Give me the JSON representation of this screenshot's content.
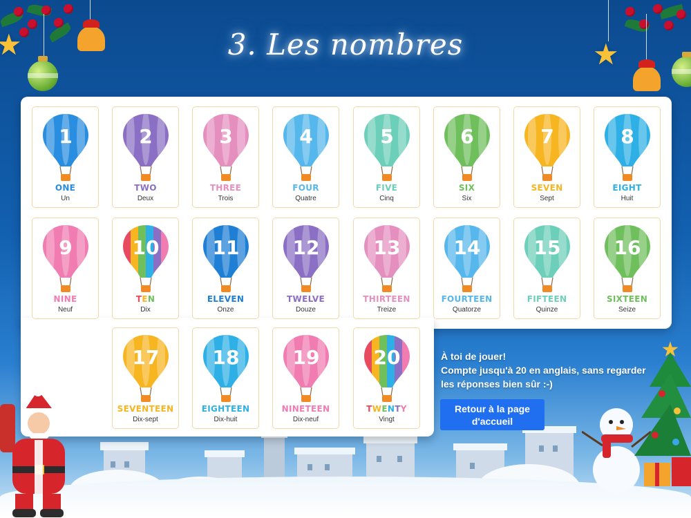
{
  "page": {
    "title": "3. Les nombres",
    "prompt_lines": [
      "À toi de jouer!",
      "Compte jusqu'à 20 en anglais, sans regarder",
      "les réponses bien sûr :-)"
    ],
    "home_button_label": "Retour à la page d'accueil"
  },
  "numbers": [
    {
      "n": "1",
      "en": "ONE",
      "fr": "Un",
      "color": "#2a8ee0"
    },
    {
      "n": "2",
      "en": "TWO",
      "fr": "Deux",
      "color": "#8a6fc4"
    },
    {
      "n": "3",
      "en": "THREE",
      "fr": "Trois",
      "color": "#e58fbf"
    },
    {
      "n": "4",
      "en": "FOUR",
      "fr": "Quatre",
      "color": "#56b7ec"
    },
    {
      "n": "5",
      "en": "FIVE",
      "fr": "Cinq",
      "color": "#6ccfb9"
    },
    {
      "n": "6",
      "en": "SIX",
      "fr": "Six",
      "color": "#6fbf5c"
    },
    {
      "n": "7",
      "en": "SEVEN",
      "fr": "Sept",
      "color": "#f7b521"
    },
    {
      "n": "8",
      "en": "EIGHT",
      "fr": "Huit",
      "color": "#2eb0e6"
    },
    {
      "n": "9",
      "en": "NINE",
      "fr": "Neuf",
      "color": "#f07cb1"
    },
    {
      "n": "10",
      "en": "TEN",
      "fr": "Dix",
      "color": "rainbow"
    },
    {
      "n": "11",
      "en": "ELEVEN",
      "fr": "Onze",
      "color": "#1e7fd4"
    },
    {
      "n": "12",
      "en": "TWELVE",
      "fr": "Douze",
      "color": "#8a6fc4"
    },
    {
      "n": "13",
      "en": "THIRTEEN",
      "fr": "Treize",
      "color": "#e58fbf"
    },
    {
      "n": "14",
      "en": "FOURTEEN",
      "fr": "Quatorze",
      "color": "#56b7ec"
    },
    {
      "n": "15",
      "en": "FIFTEEN",
      "fr": "Quinze",
      "color": "#6ccfb9"
    },
    {
      "n": "16",
      "en": "SIXTEEN",
      "fr": "Seize",
      "color": "#6fbf5c"
    },
    {
      "n": "17",
      "en": "SEVENTEEN",
      "fr": "Dix-sept",
      "color": "#f7b521"
    },
    {
      "n": "18",
      "en": "EIGHTEEN",
      "fr": "Dix-huit",
      "color": "#2eb0e6"
    },
    {
      "n": "19",
      "en": "NINETEEN",
      "fr": "Dix-neuf",
      "color": "#f07cb1"
    },
    {
      "n": "20",
      "en": "TWENTY",
      "fr": "Vingt",
      "color": "rainbow"
    }
  ],
  "icons": {
    "balloon": "hot-air-balloon-icon",
    "ornament": "christmas-ornament-icon",
    "star": "star-icon",
    "bell": "bell-icon",
    "santa": "santa-claus-icon",
    "snowman": "snowman-icon",
    "tree": "christmas-tree-icon"
  },
  "theme": {
    "background_top": "#0c4a8f",
    "button": "#1f6ff0",
    "card_border": "#f4d9a4"
  }
}
